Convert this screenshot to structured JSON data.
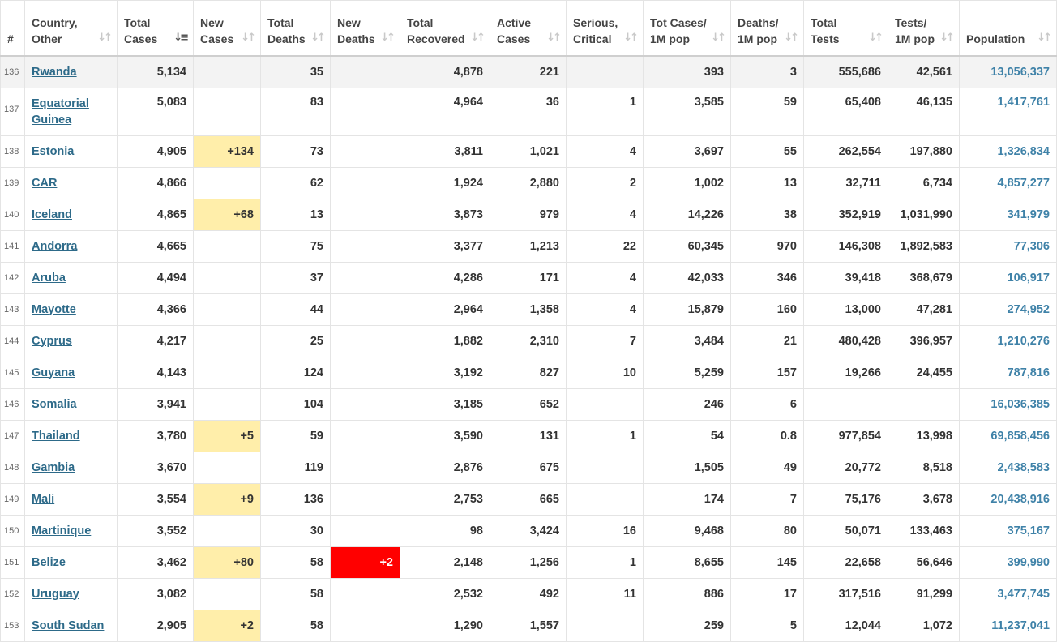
{
  "columns": [
    {
      "label_line1": "#",
      "label_line2": ""
    },
    {
      "label_line1": "Country,",
      "label_line2": "Other"
    },
    {
      "label_line1": "Total",
      "label_line2": "Cases"
    },
    {
      "label_line1": "New",
      "label_line2": "Cases"
    },
    {
      "label_line1": "Total",
      "label_line2": "Deaths"
    },
    {
      "label_line1": "New",
      "label_line2": "Deaths"
    },
    {
      "label_line1": "Total",
      "label_line2": "Recovered"
    },
    {
      "label_line1": "Active",
      "label_line2": "Cases"
    },
    {
      "label_line1": "Serious,",
      "label_line2": "Critical"
    },
    {
      "label_line1": "Tot Cases/",
      "label_line2": "1M pop"
    },
    {
      "label_line1": "Deaths/",
      "label_line2": "1M pop"
    },
    {
      "label_line1": "Total",
      "label_line2": "Tests"
    },
    {
      "label_line1": "Tests/",
      "label_line2": "1M pop"
    },
    {
      "label_line1": "Population",
      "label_line2": ""
    }
  ],
  "sort_icons": {
    "default": "sort-updown-icon",
    "active_column": "Total Cases",
    "active": "sort-descending-icon"
  },
  "colors": {
    "link": "#2d6a89",
    "population_link": "#3f82a8",
    "new_cases_bg": "#ffeeaa",
    "new_deaths_bg": "#ff0000",
    "first_row_bg": "#f3f3f3"
  },
  "rows": [
    {
      "rank": "136",
      "country": "Rwanda",
      "total_cases": "5,134",
      "new_cases": "",
      "total_deaths": "35",
      "new_deaths": "",
      "total_recovered": "4,878",
      "active_cases": "221",
      "serious_critical": "",
      "cases_per_1m": "393",
      "deaths_per_1m": "3",
      "total_tests": "555,686",
      "tests_per_1m": "42,561",
      "population": "13,056,337"
    },
    {
      "rank": "137",
      "country": "Equatorial Guinea",
      "total_cases": "5,083",
      "new_cases": "",
      "total_deaths": "83",
      "new_deaths": "",
      "total_recovered": "4,964",
      "active_cases": "36",
      "serious_critical": "1",
      "cases_per_1m": "3,585",
      "deaths_per_1m": "59",
      "total_tests": "65,408",
      "tests_per_1m": "46,135",
      "population": "1,417,761"
    },
    {
      "rank": "138",
      "country": "Estonia",
      "total_cases": "4,905",
      "new_cases": "+134",
      "total_deaths": "73",
      "new_deaths": "",
      "total_recovered": "3,811",
      "active_cases": "1,021",
      "serious_critical": "4",
      "cases_per_1m": "3,697",
      "deaths_per_1m": "55",
      "total_tests": "262,554",
      "tests_per_1m": "197,880",
      "population": "1,326,834"
    },
    {
      "rank": "139",
      "country": "CAR",
      "total_cases": "4,866",
      "new_cases": "",
      "total_deaths": "62",
      "new_deaths": "",
      "total_recovered": "1,924",
      "active_cases": "2,880",
      "serious_critical": "2",
      "cases_per_1m": "1,002",
      "deaths_per_1m": "13",
      "total_tests": "32,711",
      "tests_per_1m": "6,734",
      "population": "4,857,277"
    },
    {
      "rank": "140",
      "country": "Iceland",
      "total_cases": "4,865",
      "new_cases": "+68",
      "total_deaths": "13",
      "new_deaths": "",
      "total_recovered": "3,873",
      "active_cases": "979",
      "serious_critical": "4",
      "cases_per_1m": "14,226",
      "deaths_per_1m": "38",
      "total_tests": "352,919",
      "tests_per_1m": "1,031,990",
      "population": "341,979"
    },
    {
      "rank": "141",
      "country": "Andorra",
      "total_cases": "4,665",
      "new_cases": "",
      "total_deaths": "75",
      "new_deaths": "",
      "total_recovered": "3,377",
      "active_cases": "1,213",
      "serious_critical": "22",
      "cases_per_1m": "60,345",
      "deaths_per_1m": "970",
      "total_tests": "146,308",
      "tests_per_1m": "1,892,583",
      "population": "77,306"
    },
    {
      "rank": "142",
      "country": "Aruba",
      "total_cases": "4,494",
      "new_cases": "",
      "total_deaths": "37",
      "new_deaths": "",
      "total_recovered": "4,286",
      "active_cases": "171",
      "serious_critical": "4",
      "cases_per_1m": "42,033",
      "deaths_per_1m": "346",
      "total_tests": "39,418",
      "tests_per_1m": "368,679",
      "population": "106,917"
    },
    {
      "rank": "143",
      "country": "Mayotte",
      "total_cases": "4,366",
      "new_cases": "",
      "total_deaths": "44",
      "new_deaths": "",
      "total_recovered": "2,964",
      "active_cases": "1,358",
      "serious_critical": "4",
      "cases_per_1m": "15,879",
      "deaths_per_1m": "160",
      "total_tests": "13,000",
      "tests_per_1m": "47,281",
      "population": "274,952"
    },
    {
      "rank": "144",
      "country": "Cyprus",
      "total_cases": "4,217",
      "new_cases": "",
      "total_deaths": "25",
      "new_deaths": "",
      "total_recovered": "1,882",
      "active_cases": "2,310",
      "serious_critical": "7",
      "cases_per_1m": "3,484",
      "deaths_per_1m": "21",
      "total_tests": "480,428",
      "tests_per_1m": "396,957",
      "population": "1,210,276"
    },
    {
      "rank": "145",
      "country": "Guyana",
      "total_cases": "4,143",
      "new_cases": "",
      "total_deaths": "124",
      "new_deaths": "",
      "total_recovered": "3,192",
      "active_cases": "827",
      "serious_critical": "10",
      "cases_per_1m": "5,259",
      "deaths_per_1m": "157",
      "total_tests": "19,266",
      "tests_per_1m": "24,455",
      "population": "787,816"
    },
    {
      "rank": "146",
      "country": "Somalia",
      "total_cases": "3,941",
      "new_cases": "",
      "total_deaths": "104",
      "new_deaths": "",
      "total_recovered": "3,185",
      "active_cases": "652",
      "serious_critical": "",
      "cases_per_1m": "246",
      "deaths_per_1m": "6",
      "total_tests": "",
      "tests_per_1m": "",
      "population": "16,036,385"
    },
    {
      "rank": "147",
      "country": "Thailand",
      "total_cases": "3,780",
      "new_cases": "+5",
      "total_deaths": "59",
      "new_deaths": "",
      "total_recovered": "3,590",
      "active_cases": "131",
      "serious_critical": "1",
      "cases_per_1m": "54",
      "deaths_per_1m": "0.8",
      "total_tests": "977,854",
      "tests_per_1m": "13,998",
      "population": "69,858,456"
    },
    {
      "rank": "148",
      "country": "Gambia",
      "total_cases": "3,670",
      "new_cases": "",
      "total_deaths": "119",
      "new_deaths": "",
      "total_recovered": "2,876",
      "active_cases": "675",
      "serious_critical": "",
      "cases_per_1m": "1,505",
      "deaths_per_1m": "49",
      "total_tests": "20,772",
      "tests_per_1m": "8,518",
      "population": "2,438,583"
    },
    {
      "rank": "149",
      "country": "Mali",
      "total_cases": "3,554",
      "new_cases": "+9",
      "total_deaths": "136",
      "new_deaths": "",
      "total_recovered": "2,753",
      "active_cases": "665",
      "serious_critical": "",
      "cases_per_1m": "174",
      "deaths_per_1m": "7",
      "total_tests": "75,176",
      "tests_per_1m": "3,678",
      "population": "20,438,916"
    },
    {
      "rank": "150",
      "country": "Martinique",
      "total_cases": "3,552",
      "new_cases": "",
      "total_deaths": "30",
      "new_deaths": "",
      "total_recovered": "98",
      "active_cases": "3,424",
      "serious_critical": "16",
      "cases_per_1m": "9,468",
      "deaths_per_1m": "80",
      "total_tests": "50,071",
      "tests_per_1m": "133,463",
      "population": "375,167"
    },
    {
      "rank": "151",
      "country": "Belize",
      "total_cases": "3,462",
      "new_cases": "+80",
      "total_deaths": "58",
      "new_deaths": "+2",
      "total_recovered": "2,148",
      "active_cases": "1,256",
      "serious_critical": "1",
      "cases_per_1m": "8,655",
      "deaths_per_1m": "145",
      "total_tests": "22,658",
      "tests_per_1m": "56,646",
      "population": "399,990"
    },
    {
      "rank": "152",
      "country": "Uruguay",
      "total_cases": "3,082",
      "new_cases": "",
      "total_deaths": "58",
      "new_deaths": "",
      "total_recovered": "2,532",
      "active_cases": "492",
      "serious_critical": "11",
      "cases_per_1m": "886",
      "deaths_per_1m": "17",
      "total_tests": "317,516",
      "tests_per_1m": "91,299",
      "population": "3,477,745"
    },
    {
      "rank": "153",
      "country": "South Sudan",
      "total_cases": "2,905",
      "new_cases": "+2",
      "total_deaths": "58",
      "new_deaths": "",
      "total_recovered": "1,290",
      "active_cases": "1,557",
      "serious_critical": "",
      "cases_per_1m": "259",
      "deaths_per_1m": "5",
      "total_tests": "12,044",
      "tests_per_1m": "1,072",
      "population": "11,237,041"
    }
  ]
}
